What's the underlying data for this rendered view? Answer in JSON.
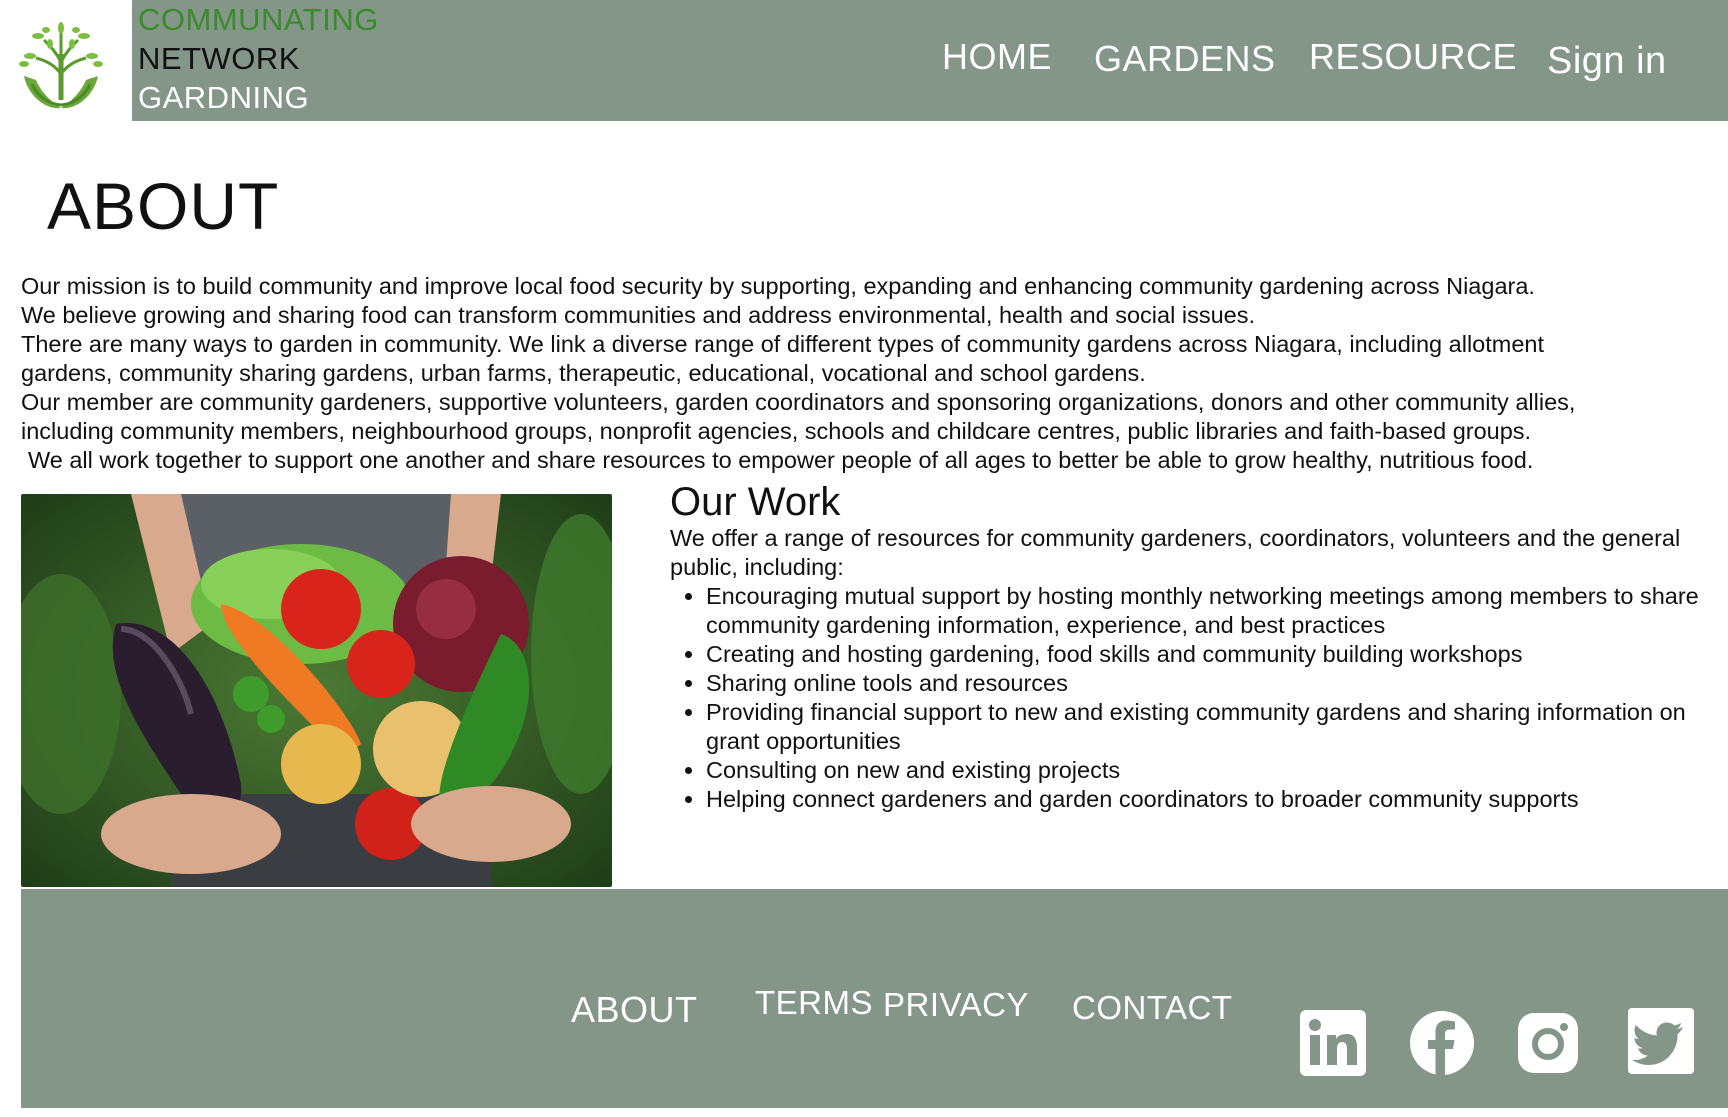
{
  "brand": {
    "line1": "COMMUNATING",
    "line2": "NETWORK",
    "line3": "GARDNING"
  },
  "nav": {
    "home": "HOME",
    "gardens": "GARDENS",
    "resource": "RESOURCE",
    "signin": "Sign in"
  },
  "page_title": "ABOUT",
  "mission": [
    "Our mission is to build community and improve local food security by supporting, expanding and enhancing community gardening across Niagara.",
    "We believe growing and sharing food can transform communities and address environmental, health and social issues.",
    "There are many ways to garden in community.  We link a diverse range of different types of community gardens across Niagara, including allotment",
    "gardens, community sharing gardens, urban farms, therapeutic, educational, vocational and school gardens.",
    "Our member are community gardeners, supportive volunteers, garden coordinators and sponsoring organizations, donors and other community allies,",
    "including community members, neighbourhood groups, nonprofit agencies, schools and childcare centres, public libraries and faith-based groups.",
    "We all work together to support one another and share resources to empower people of all ages to better be able to grow healthy, nutritious food."
  ],
  "work": {
    "title": "Our Work",
    "intro": "We offer a range of resources for community gardeners, coordinators, volunteers and the general public, including:",
    "items": [
      "Encouraging mutual support by hosting monthly networking meetings among members to share community gardening information, experience, and best practices",
      "Creating and hosting gardening, food skills and community building workshops",
      "Sharing online tools and resources",
      "Providing financial support to new and existing community gardens and sharing information on grant opportunities",
      "Consulting on new and existing projects",
      "Helping connect gardeners and garden coordinators to broader community supports"
    ]
  },
  "footer": {
    "about": "ABOUT",
    "terms": "TERMS",
    "privacy": "PRIVACY",
    "contact": "CONTACT",
    "social_icons": [
      "linkedin-icon",
      "facebook-icon",
      "instagram-icon",
      "twitter-icon"
    ]
  },
  "colors": {
    "header_bg": "#839688",
    "footer_bg": "#839688",
    "brand_green": "#3a8a2e",
    "nav_text": "#ffffff"
  }
}
